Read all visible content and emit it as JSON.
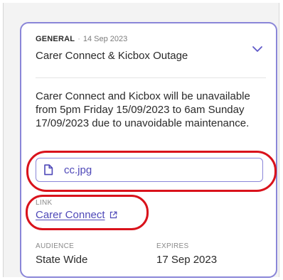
{
  "announcement": {
    "category": "GENERAL",
    "separator": "·",
    "date": "14 Sep 2023",
    "title": "Carer Connect & Kicbox Outage",
    "body": "Carer Connect and Kicbox will be unavailable from 5pm Friday 15/09/2023 to 6am Sunday 17/09/2023 due to unavoidable maintenance.",
    "attachment": {
      "file_name": "cc.jpg",
      "icon": "file-icon"
    },
    "link": {
      "label": "LINK",
      "text": "Carer Connect",
      "icon": "external-link-icon"
    },
    "audience": {
      "label": "AUDIENCE",
      "value": "State Wide"
    },
    "expires": {
      "label": "EXPIRES",
      "value": "17 Sep 2023"
    },
    "expand_icon": "chevron-down-icon"
  },
  "colors": {
    "card_border": "#8a86d8",
    "accent_text": "#4e48b8",
    "annotation": "#d9121b",
    "frame_background": "#f3f3f3"
  }
}
